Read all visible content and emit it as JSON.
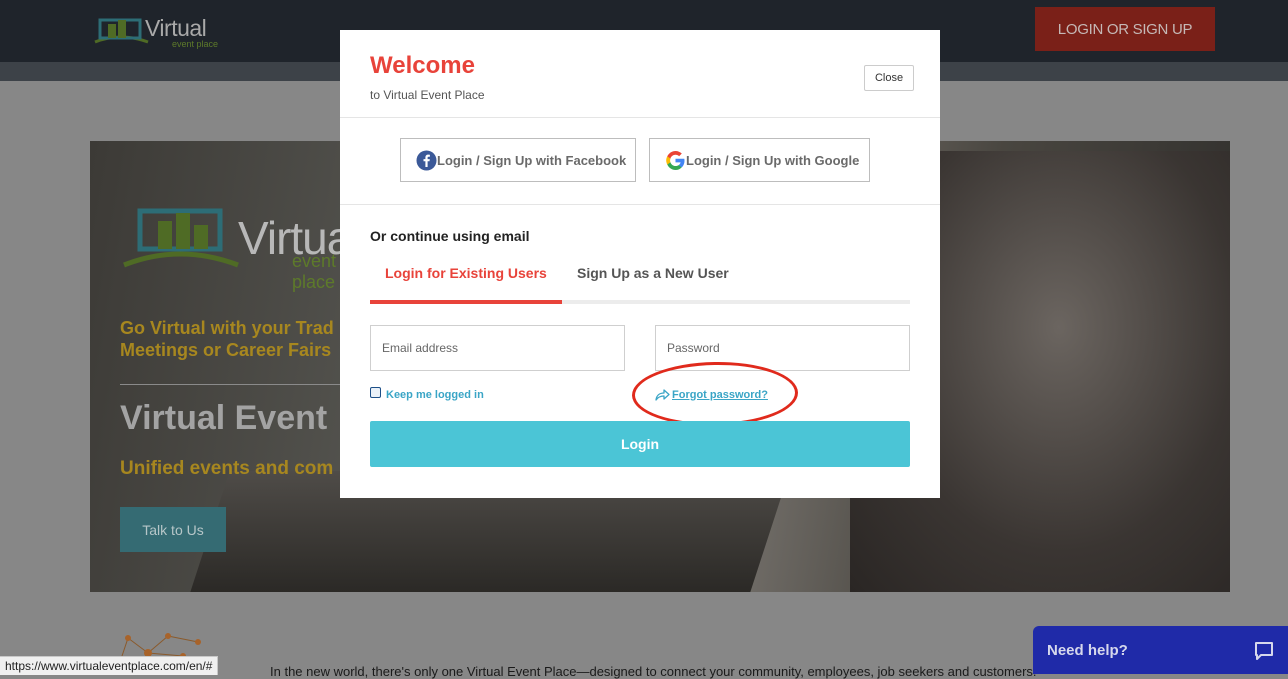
{
  "header": {
    "logo_word": "Virtual",
    "logo_sub": "event place",
    "login_signup_label": "LOGIN OR SIGN UP"
  },
  "hero": {
    "logo_word": "Virtual",
    "logo_sub": "event place",
    "tagline": "Go Virtual with your Trad\nMeetings or Career Fairs",
    "title": "Virtual Event",
    "subtitle": "Unified events and com",
    "talk_button": "Talk to Us"
  },
  "body_text": "In the new world, there's only one Virtual Event Place—designed to connect your community, employees, job seekers and customers.",
  "status_url": "https://www.virtualeventplace.com/en/#",
  "help_widget": {
    "label": "Need help?"
  },
  "modal": {
    "title": "Welcome",
    "subtitle": "to Virtual Event Place",
    "close_label": "Close",
    "facebook_label": "Login / Sign Up with Facebook",
    "google_label": "Login / Sign Up with Google",
    "or_label": "Or continue using email",
    "tabs": [
      {
        "label": "Login for Existing Users",
        "active": true
      },
      {
        "label": "Sign Up as a New User",
        "active": false
      }
    ],
    "email_placeholder": "Email address",
    "password_placeholder": "Password",
    "remember_label": "Keep me logged in",
    "forgot_label": "Forgot password?",
    "login_button": "Login"
  },
  "colors": {
    "accent_red": "#e8433a",
    "button_teal": "#4bc5d6",
    "link_teal": "#3aa5c6",
    "annotation_red": "#e02a1c",
    "help_blue": "#1f2aa8"
  },
  "icons": [
    "facebook-icon",
    "google-icon",
    "forward-arrow-icon",
    "chat-icon",
    "network-icon",
    "logo-building-icon"
  ]
}
